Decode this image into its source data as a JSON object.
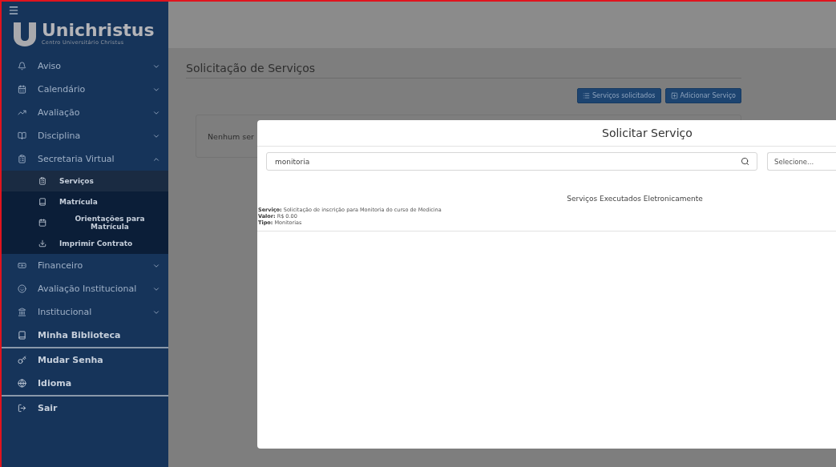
{
  "sidebar": {
    "logo": {
      "name": "Unichristus",
      "tagline": "Centro Universitário Christus"
    },
    "sections": [
      {
        "items": [
          {
            "kind": "group",
            "label": "Aviso",
            "expanded": false
          },
          {
            "kind": "group",
            "label": "Calendário",
            "expanded": false
          },
          {
            "kind": "group",
            "label": "Avaliação",
            "expanded": false
          },
          {
            "kind": "group",
            "label": "Disciplina",
            "expanded": false
          },
          {
            "kind": "group",
            "label": "Secretaria Virtual",
            "expanded": true,
            "children": [
              {
                "label": "Serviços",
                "selected": true
              },
              {
                "label": "Matrícula",
                "selected": false
              },
              {
                "label": "Orientações para Matrícula",
                "selected": false
              },
              {
                "label": "Imprimir Contrato",
                "selected": false
              }
            ]
          },
          {
            "kind": "group",
            "label": "Financeiro",
            "expanded": false
          },
          {
            "kind": "group",
            "label": "Avaliação Institucional",
            "expanded": false
          },
          {
            "kind": "group",
            "label": "Institucional",
            "expanded": false
          },
          {
            "kind": "link",
            "label": "Minha Biblioteca"
          }
        ]
      },
      {
        "items": [
          {
            "kind": "link",
            "label": "Mudar Senha"
          },
          {
            "kind": "link",
            "label": "Idioma"
          }
        ]
      },
      {
        "items": [
          {
            "kind": "link",
            "label": "Sair"
          }
        ]
      }
    ]
  },
  "page": {
    "title": "Solicitação de Serviços",
    "buttons": [
      "Serviços solicitados",
      "Adicionar Serviço"
    ],
    "empty_message": "Nenhum ser"
  },
  "modal": {
    "title": "Solicitar Serviço",
    "search": {
      "value": "monitoria"
    },
    "filter": {
      "value": "Selecione..."
    },
    "section_title": "Serviços Executados Eletronicamente",
    "results": [
      {
        "lines": [
          "**Serviço:** Solicitação de inscrição para Monitoria do curso de Medicina",
          "**Valor:** R$ 0.00",
          "**Tipo:** Monitorias"
        ]
      }
    ]
  }
}
